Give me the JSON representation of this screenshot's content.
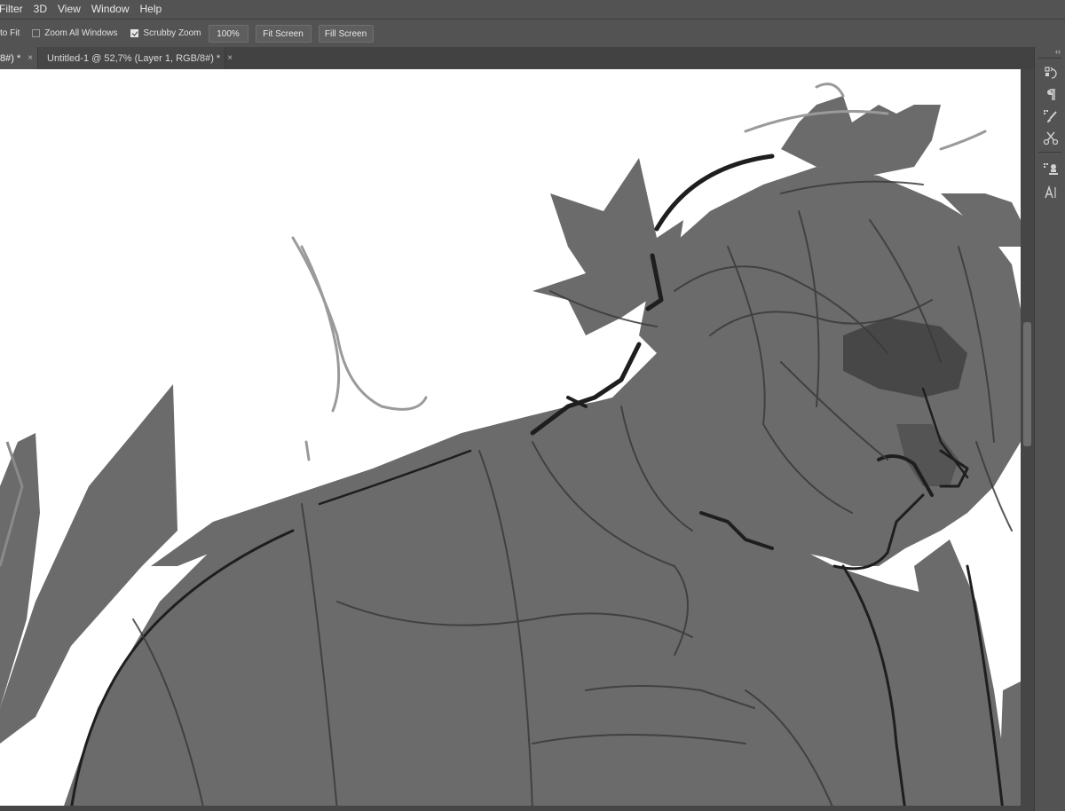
{
  "menu": {
    "items": [
      "Filter",
      "3D",
      "View",
      "Window",
      "Help"
    ]
  },
  "options": {
    "fit_label": "to Fit",
    "zoom_all_windows": {
      "label": "Zoom All Windows",
      "checked": false
    },
    "scrubby_zoom": {
      "label": "Scrubby Zoom",
      "checked": true
    },
    "btn_100": "100%",
    "btn_fit_screen": "Fit Screen",
    "btn_fill_screen": "Fill Screen"
  },
  "tabs": [
    {
      "label": "8#) *",
      "active": true
    },
    {
      "label": "Untitled-1 @ 52,7% (Layer 1, RGB/8#) *",
      "active": false
    }
  ],
  "tab_close": "×",
  "panel": {
    "collapse": "‹‹",
    "icons": [
      "history-icon",
      "paragraph-icon",
      "brush-presets-icon",
      "tool-presets-icon",
      "clone-source-icon",
      "character-icon"
    ]
  },
  "colors": {
    "ui_bg": "#535353",
    "tab_bar": "#424242",
    "canvas_white": "#ffffff",
    "figure_gray": "#6b6b6b",
    "line_dark": "#1e1e1e"
  }
}
